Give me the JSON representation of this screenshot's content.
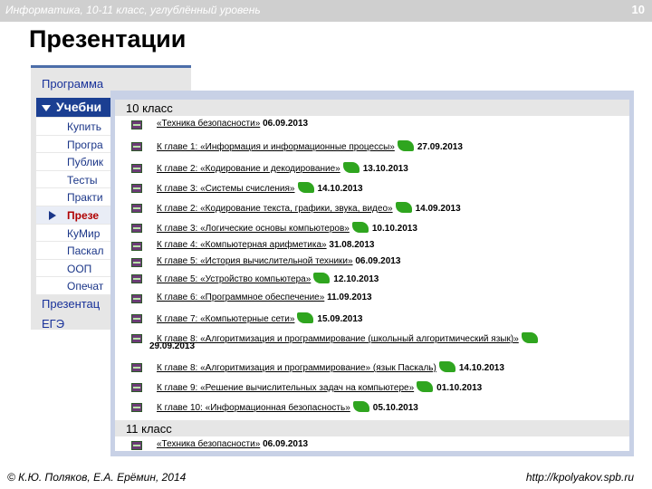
{
  "header": {
    "course": "Информатика, 10-11 класс, углублённый уровень",
    "page_number": "10"
  },
  "title": "Презентации",
  "sidebar": {
    "top_item": "Программа",
    "section": "Учебни",
    "subitems": [
      "Купить",
      "Програ",
      "Публик",
      "Тесты",
      "Практи",
      "Презе",
      "КуМир",
      "Паскал",
      "ООП",
      "Опечат"
    ],
    "current_index": 5,
    "bottom_items": [
      "Презентац",
      "ЕГЭ"
    ]
  },
  "panel": {
    "grade10": "10 класс",
    "grade11": "11 класс",
    "rows10": [
      {
        "text": "«Техника безопасности»",
        "date": "06.09.2013",
        "flag": false
      },
      {
        "text": "К главе 1: «Информация и информационные процессы»",
        "date": "27.09.2013",
        "flag": true
      },
      {
        "text": "К главе 2: «Кодирование и декодирование»",
        "date": "13.10.2013",
        "flag": true
      },
      {
        "text": "К главе 3: «Системы счисления»",
        "date": "14.10.2013",
        "flag": true
      },
      {
        "text": "К главе 2: «Кодирование текста, графики, звука, видео»",
        "date": "14.09.2013",
        "flag": true
      },
      {
        "text": "К главе 3: «Логические основы компьютеров»",
        "date": "10.10.2013",
        "flag": true
      },
      {
        "text": "К главе 4: «Компьютерная арифметика»",
        "date": "31.08.2013",
        "flag": false
      },
      {
        "text": "К главе 5: «История вычислительной техники»",
        "date": "06.09.2013",
        "flag": false
      },
      {
        "text": "К главе 5: «Устройство компьютера»",
        "date": "12.10.2013",
        "flag": true
      },
      {
        "text": "К главе 6: «Программное обеспечение»",
        "date": "11.09.2013",
        "flag": false
      },
      {
        "text": "К главе 7: «Компьютерные сети»",
        "date": "15.09.2013",
        "flag": true
      },
      {
        "text": "К главе 8: «Алгоритмизация и программирование (школьный алгоритмический язык)»",
        "date": "29.09.2013",
        "flag": true
      },
      {
        "text": "К главе 8: «Алгоритмизация и программирование» (язык Паскаль)",
        "date": "14.10.2013",
        "flag": true
      },
      {
        "text": "К главе 9: «Решение вычислительных задач на компьютере»",
        "date": "01.10.2013",
        "flag": true
      },
      {
        "text": "К главе 10: «Информационная безопасность»",
        "date": "05.10.2013",
        "flag": true
      }
    ],
    "rows11": [
      {
        "text": "«Техника безопасности»",
        "date": "06.09.2013",
        "flag": false
      }
    ]
  },
  "footer": {
    "author": "© К.Ю. Поляков, Е.А. Ерёмин, 2014",
    "url": "http://kpolyakov.spb.ru"
  },
  "colors": {
    "nav_blue": "#1b3f92",
    "flag_green": "#2fa51f",
    "panel_bg": "#c8d1e6"
  },
  "icons": {
    "row_icon": "book-icon",
    "new_marker": "green-flag-icon"
  }
}
